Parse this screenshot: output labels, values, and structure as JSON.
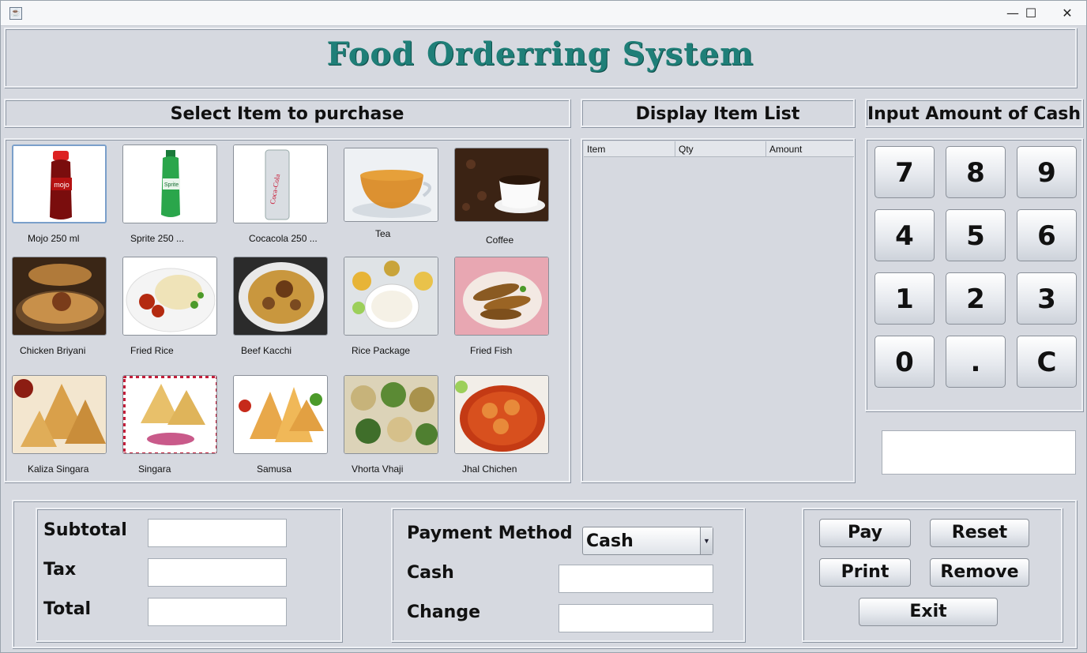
{
  "window": {
    "app_icon": "java-icon",
    "minimize": "—",
    "maximize": "☐",
    "close": "✕"
  },
  "header": {
    "title": "Food Orderring System"
  },
  "sections": {
    "select_items": "Select Item to purchase",
    "display_list": "Display Item List",
    "input_cash": "Input Amount of Cash"
  },
  "items": [
    {
      "label": "Mojo 250 ml"
    },
    {
      "label": "Sprite 250 ..."
    },
    {
      "label": "Cocacola 250 ..."
    },
    {
      "label": "Tea"
    },
    {
      "label": "Coffee"
    },
    {
      "label": "Chicken Briyani"
    },
    {
      "label": "Fried Rice"
    },
    {
      "label": "Beef Kacchi"
    },
    {
      "label": "Rice Package"
    },
    {
      "label": "Fried Fish"
    },
    {
      "label": "Kaliza Singara"
    },
    {
      "label": "Singara"
    },
    {
      "label": "Samusa"
    },
    {
      "label": "Vhorta Vhaji"
    },
    {
      "label": "Jhal Chichen"
    }
  ],
  "table": {
    "columns": [
      "Item",
      "Qty",
      "Amount"
    ],
    "rows": []
  },
  "keypad": [
    "7",
    "8",
    "9",
    "4",
    "5",
    "6",
    "1",
    "2",
    "3",
    "0",
    ".",
    "C"
  ],
  "totals": {
    "subtotal_label": "Subtotal",
    "tax_label": "Tax",
    "total_label": "Total"
  },
  "payment": {
    "method_label": "Payment Method",
    "method_value": "Cash",
    "cash_label": "Cash",
    "change_label": "Change"
  },
  "actions": {
    "pay": "Pay",
    "reset": "Reset",
    "print": "Print",
    "remove": "Remove",
    "exit": "Exit"
  }
}
